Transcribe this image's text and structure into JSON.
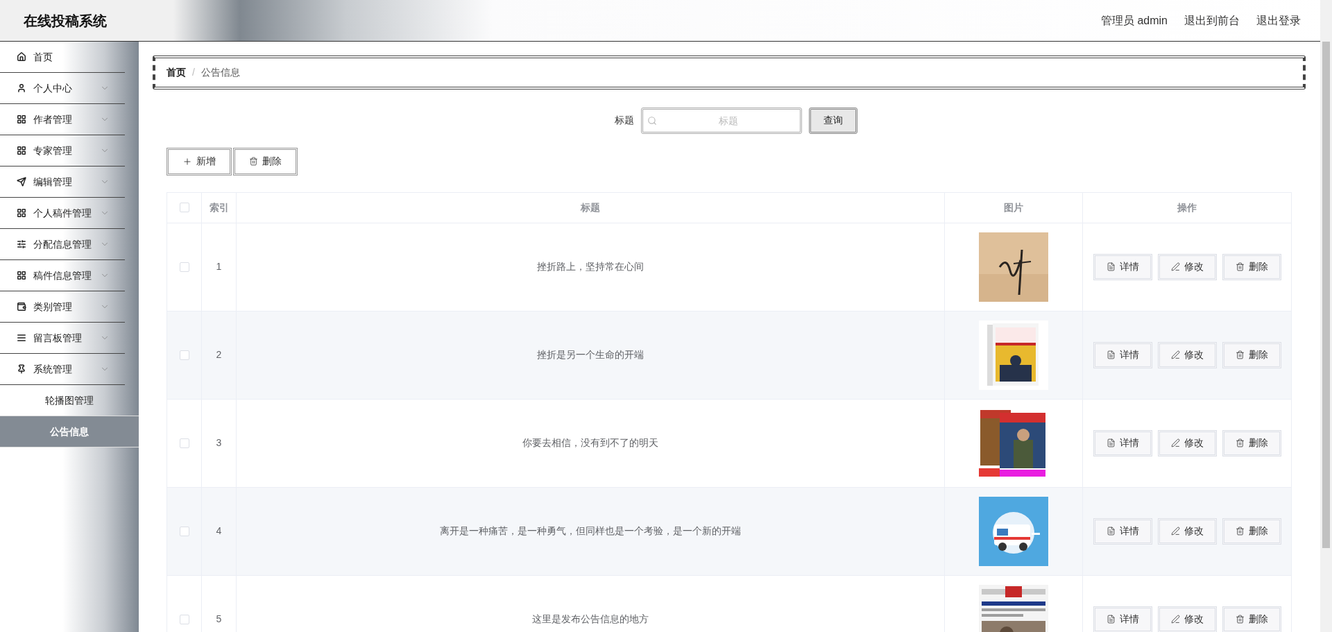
{
  "header": {
    "title": "在线投稿系统",
    "links": [
      "管理员 admin",
      "退出到前台",
      "退出登录"
    ]
  },
  "sidebar": {
    "items": [
      {
        "label": "首页",
        "selected": false
      },
      {
        "label": "个人中心",
        "selected": false,
        "expandable": true
      },
      {
        "label": "作者管理",
        "selected": false,
        "expandable": true
      },
      {
        "label": "专家管理",
        "selected": false,
        "expandable": true
      },
      {
        "label": "编辑管理",
        "selected": false,
        "expandable": true
      },
      {
        "label": "个人稿件管理",
        "selected": false,
        "expandable": true
      },
      {
        "label": "分配信息管理",
        "selected": false,
        "expandable": true
      },
      {
        "label": "稿件信息管理",
        "selected": false,
        "expandable": true
      },
      {
        "label": "类别管理",
        "selected": false,
        "expandable": true
      },
      {
        "label": "留言板管理",
        "selected": false,
        "expandable": true
      },
      {
        "label": "系统管理",
        "selected": false,
        "expandable": true,
        "children": [
          {
            "label": "轮播图管理",
            "selected": false
          },
          {
            "label": "公告信息",
            "selected": true
          }
        ]
      }
    ]
  },
  "breadcrumb": {
    "separator": "/",
    "items": [
      "首页",
      "公告信息"
    ]
  },
  "search": {
    "label": "标题",
    "placeholder": "标题",
    "button": "查询"
  },
  "toolbar": [
    "新增",
    "删除"
  ],
  "table": {
    "select_all": {
      "checked": false
    },
    "columns": [
      "索引",
      "标题",
      "图片",
      "操作"
    ],
    "rows": [
      {
        "checked": false,
        "index": "1",
        "title": "挫折路上，坚持常在心间",
        "image": {
          "kind": "picture"
        },
        "actions": [
          "详情",
          "修改",
          "删除"
        ]
      },
      {
        "checked": false,
        "index": "2",
        "title": "挫折是另一个生命的开端",
        "image": {
          "kind": "picture"
        },
        "actions": [
          "详情",
          "修改",
          "删除"
        ]
      },
      {
        "checked": false,
        "index": "3",
        "title": "你要去相信，没有到不了的明天",
        "image": {
          "kind": "picture"
        },
        "actions": [
          "详情",
          "修改",
          "删除"
        ]
      },
      {
        "checked": false,
        "index": "4",
        "title": "离开是一种痛苦，是一种勇气，但同样也是一个考验，是一个新的开端",
        "image": {
          "kind": "picture"
        },
        "actions": [
          "详情",
          "修改",
          "删除"
        ]
      },
      {
        "checked": false,
        "index": "5",
        "title": "这里是发布公告信息的地方",
        "image": {
          "kind": "picture"
        },
        "actions": [
          "详情",
          "修改",
          "删除"
        ]
      }
    ]
  }
}
